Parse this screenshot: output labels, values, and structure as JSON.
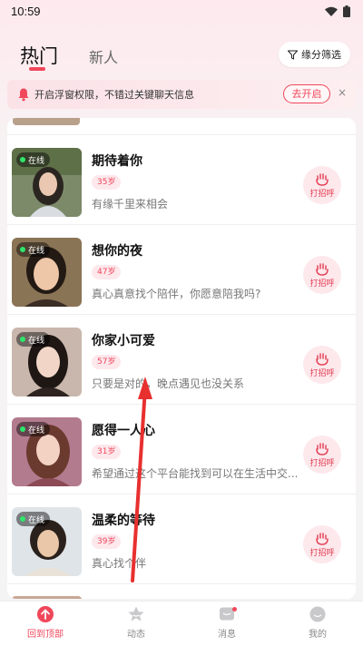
{
  "status_bar": {
    "time": "10:59"
  },
  "tabs": {
    "hot": "热门",
    "new": "新人"
  },
  "filter": {
    "label": "缘分筛选"
  },
  "notice": {
    "text": "开启浮窗权限，不错过关键聊天信息",
    "open_label": "去开启",
    "close_label": "×"
  },
  "online_label": "在线",
  "greet_label": "打招呼",
  "users": [
    {
      "name": "期待着你",
      "age": "35岁",
      "bio": "有缘千里来相会"
    },
    {
      "name": "想你的夜",
      "age": "47岁",
      "bio": "真心真意找个陪伴，你愿意陪我吗?"
    },
    {
      "name": "你家小可爱",
      "age": "57岁",
      "bio": "只要是对的，晚点遇见也没关系"
    },
    {
      "name": "愿得一人心",
      "age": "31岁",
      "bio": "希望通过这个平台能找到可以在生活中交..."
    },
    {
      "name": "温柔的等待",
      "age": "39岁",
      "bio": "真心找个伴"
    }
  ],
  "bottom_nav": [
    {
      "label": "回到顶部",
      "icon": "arrow-up-circle-icon",
      "active": true
    },
    {
      "label": "动态",
      "icon": "star-icon"
    },
    {
      "label": "消息",
      "icon": "message-icon"
    },
    {
      "label": "我的",
      "icon": "profile-icon"
    }
  ],
  "colors": {
    "accent": "#f0475b",
    "online": "#2ee66a",
    "age_bg": "#fde8ec"
  }
}
